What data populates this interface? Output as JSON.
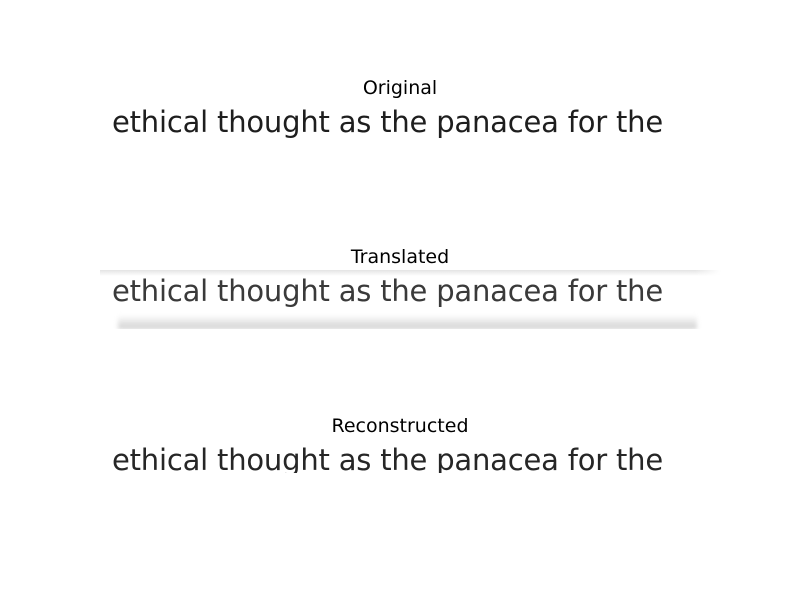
{
  "panels": {
    "original": {
      "title": "Original",
      "text": "ethical thought as the panacea for the"
    },
    "translated": {
      "title": "Translated",
      "text": "ethical thought as the panacea for the"
    },
    "reconstructed": {
      "title": "Reconstructed",
      "text": "ethical thought as the panacea for the"
    }
  }
}
